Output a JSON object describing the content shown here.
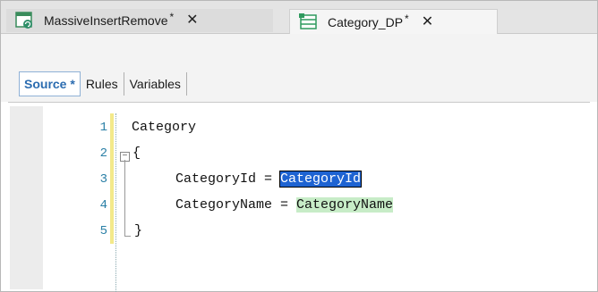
{
  "tabs": [
    {
      "label": "MassiveInsertRemove",
      "modified": "*",
      "icon": "transaction-icon"
    },
    {
      "label": "Category_DP",
      "modified": "*",
      "icon": "data-provider-icon"
    }
  ],
  "close_glyph": "✕",
  "subtabs": [
    {
      "label": "Source *"
    },
    {
      "label": "Rules"
    },
    {
      "label": "Variables"
    }
  ],
  "editor": {
    "line_numbers": [
      "1",
      "2",
      "3",
      "4",
      "5"
    ],
    "lines": {
      "l1": "Category",
      "l2": "{",
      "l3_left": "CategoryId = ",
      "l3_sel": "CategoryId",
      "l4_left": "CategoryName = ",
      "l4_hl": "CategoryName",
      "l5": "}"
    },
    "fold_symbol": "−"
  },
  "colors": {
    "accent": "#2b6cb0",
    "selection": "#1e63d2",
    "match_highlight": "#c7ecc7",
    "line_number": "#2a7fa6",
    "change_bar": "#f3e98a"
  }
}
